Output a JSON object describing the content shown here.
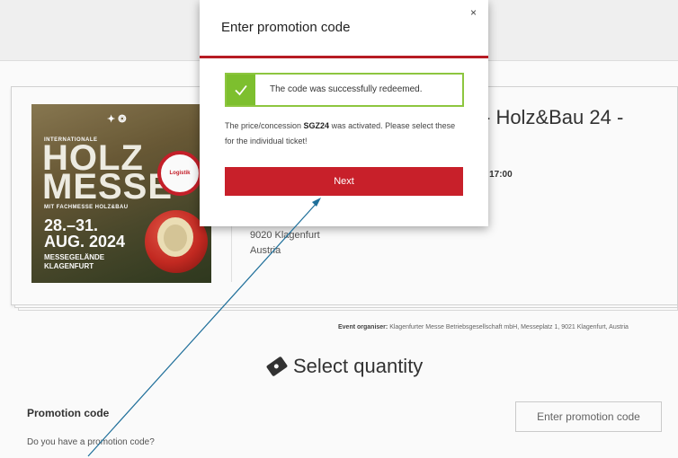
{
  "modal": {
    "title": "Enter promotion code",
    "close": "×",
    "alert_text": "The code was successfully redeemed.",
    "info_pre": "The price/concession ",
    "info_code": "SGZ24",
    "info_post": " was activated. Please select these for the individual ticket!",
    "next_label": "Next"
  },
  "event": {
    "title_visible": "- Holz&Bau 24 -",
    "time_visible": "t 17:00",
    "address_line1": "9020 Klagenfurt",
    "address_line2": "Austria",
    "poster": {
      "international": "INTERNATIONALE",
      "holz": "HOLZ",
      "messe": "MESSE",
      "fach": "MIT FACHMESSE HOLZ&BAU",
      "date1": "28.–31.",
      "date2": "AUG. 2024",
      "loc1": "MESSEGELÄNDE",
      "loc2": "KLAGENFURT",
      "badge": "Logistik"
    }
  },
  "organiser": {
    "label": "Event organiser:",
    "value": " Klagenfurter Messe Betriebsgesellschaft mbH, Messeplatz 1, 9021 Klagenfurt, Austria"
  },
  "quantity": {
    "heading": "Select quantity"
  },
  "promotion": {
    "label": "Promotion code",
    "question": "Do you have a promotion code?",
    "button_label": "Enter promotion code"
  },
  "colors": {
    "accent_red": "#c8202a",
    "success_green": "#7dbf2e"
  }
}
